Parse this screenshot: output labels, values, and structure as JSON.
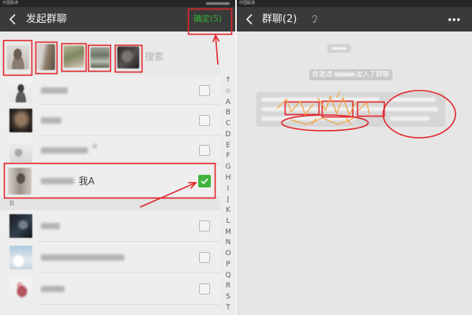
{
  "colors": {
    "header_bg": "#3a3a3a",
    "status_bg": "#262626",
    "confirm_green": "#33b433",
    "check_green": "#3fb53c",
    "annotation_red": "#e2262b",
    "scribble_orange": "#f2a23a"
  },
  "status_bar": {
    "left_carrier": "中国联通",
    "right_carrier": "中国联通"
  },
  "left_panel": {
    "header": {
      "back_icon": "chevron-left-icon",
      "title": "发起群聊",
      "confirm_label": "确定(5)"
    },
    "selected_members": {
      "count": 5
    },
    "search": {
      "placeholder": "搜索"
    },
    "contacts": [
      {
        "checked": false
      },
      {
        "checked": false
      },
      {
        "checked": false
      },
      {
        "name": "我A",
        "checked": true
      },
      {
        "checked": false
      },
      {
        "checked": false
      },
      {
        "checked": false
      }
    ],
    "section_header": "B",
    "index_bar": [
      "↑",
      "☆",
      "A",
      "B",
      "C",
      "D",
      "E",
      "F",
      "G",
      "H",
      "I",
      "J",
      "K",
      "L",
      "M",
      "N",
      "O",
      "P",
      "Q",
      "R",
      "S",
      "T"
    ]
  },
  "right_panel": {
    "header": {
      "back_icon": "chevron-left-icon",
      "title": "群聊(2)",
      "status_icon": "earpiece-icon",
      "more_icon": "more-dots-icon"
    },
    "system_message": {
      "prefix": "你邀请",
      "suffix": "加入了群聊"
    }
  }
}
